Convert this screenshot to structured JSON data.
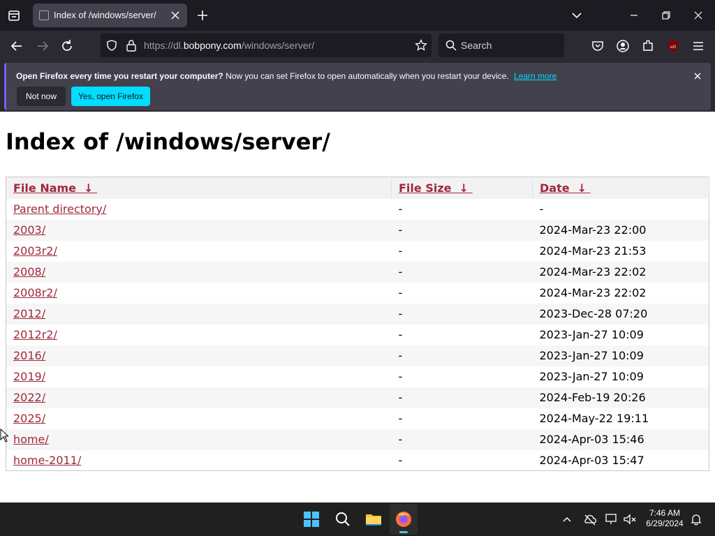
{
  "browser": {
    "tab_title": "Index of /windows/server/",
    "url_prefix": "https://dl.",
    "url_domain": "bobpony.com",
    "url_path": "/windows/server/",
    "search_placeholder": "Search"
  },
  "notification": {
    "bold_text": "Open Firefox every time you restart your computer?",
    "text": "Now you can set Firefox to open automatically when you restart your device.",
    "learn_more": "Learn more",
    "not_now": "Not now",
    "yes_open": "Yes, open Firefox"
  },
  "page": {
    "heading": "Index of /windows/server/",
    "columns": {
      "name": "File Name",
      "size": "File Size",
      "date": "Date",
      "sort_arrow": "↓"
    },
    "rows": [
      {
        "name": "Parent directory/",
        "size": "-",
        "date": "-"
      },
      {
        "name": "2003/",
        "size": "-",
        "date": "2024-Mar-23 22:00"
      },
      {
        "name": "2003r2/",
        "size": "-",
        "date": "2024-Mar-23 21:53"
      },
      {
        "name": "2008/",
        "size": "-",
        "date": "2024-Mar-23 22:02"
      },
      {
        "name": "2008r2/",
        "size": "-",
        "date": "2024-Mar-23 22:02"
      },
      {
        "name": "2012/",
        "size": "-",
        "date": "2023-Dec-28 07:20"
      },
      {
        "name": "2012r2/",
        "size": "-",
        "date": "2023-Jan-27 10:09"
      },
      {
        "name": "2016/",
        "size": "-",
        "date": "2023-Jan-27 10:09"
      },
      {
        "name": "2019/",
        "size": "-",
        "date": "2023-Jan-27 10:09"
      },
      {
        "name": "2022/",
        "size": "-",
        "date": "2024-Feb-19 20:26"
      },
      {
        "name": "2025/",
        "size": "-",
        "date": "2024-May-22 19:11"
      },
      {
        "name": "home/",
        "size": "-",
        "date": "2024-Apr-03 15:46"
      },
      {
        "name": "home-2011/",
        "size": "-",
        "date": "2024-Apr-03 15:47"
      }
    ]
  },
  "taskbar": {
    "time": "7:46 AM",
    "date": "6/29/2024"
  },
  "colors": {
    "link": "#a0283b",
    "accent": "#00ddff"
  }
}
